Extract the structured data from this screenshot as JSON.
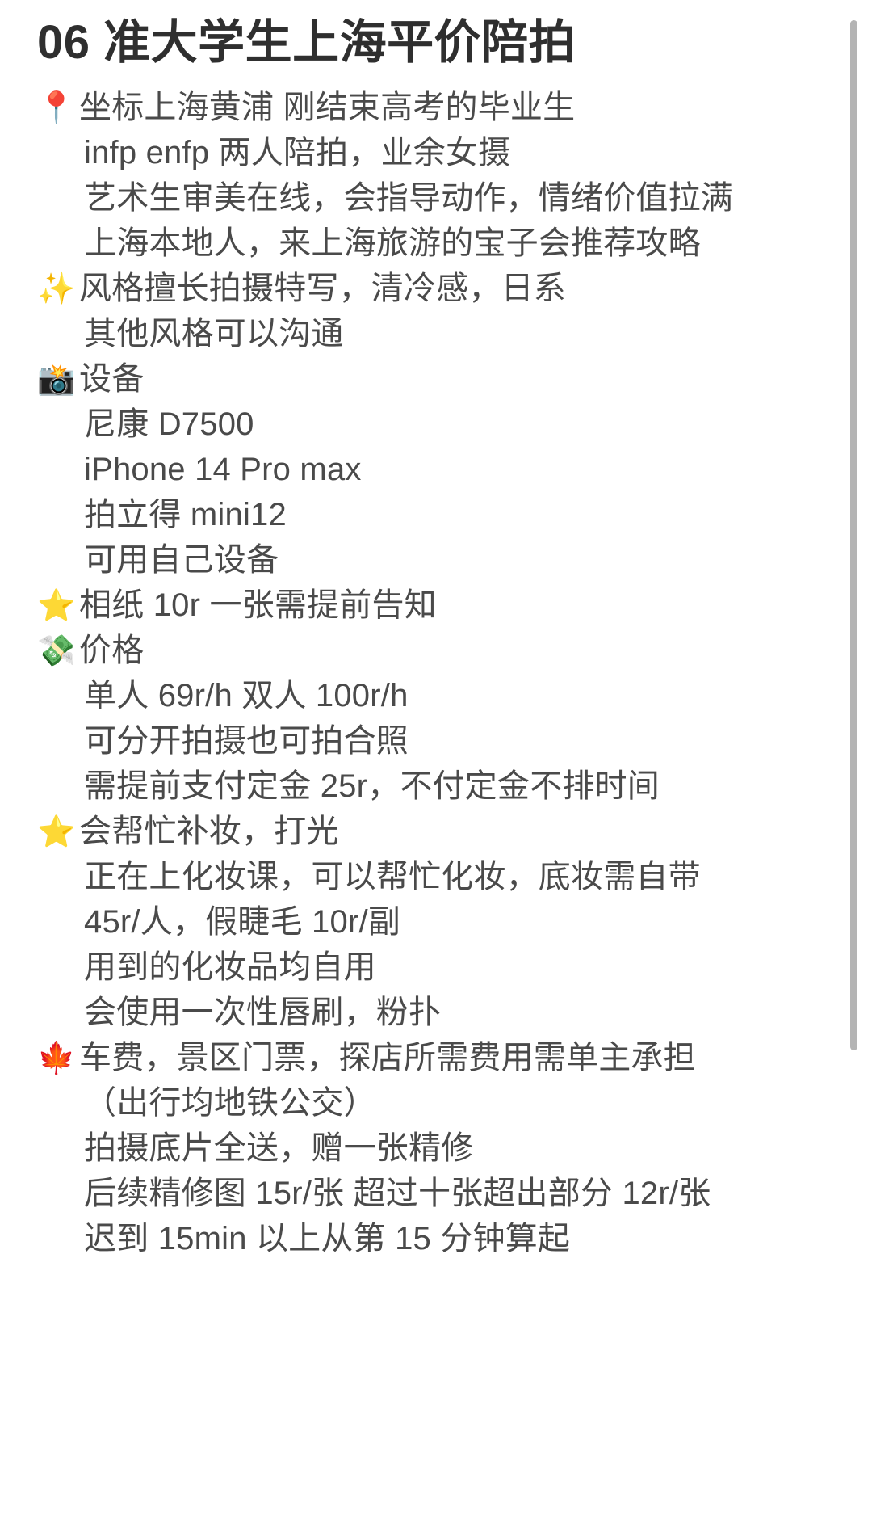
{
  "note": {
    "title": "06 准大学生上海平价陪拍",
    "lines": [
      {
        "emoji": "📍",
        "text": "坐标上海黄浦 刚结束高考的毕业生",
        "indent": false
      },
      {
        "emoji": "",
        "text": "infp enfp 两人陪拍，业余女摄",
        "indent": true
      },
      {
        "emoji": "",
        "text": "艺术生审美在线，会指导动作，情绪价值拉满",
        "indent": true
      },
      {
        "emoji": "",
        "text": "上海本地人，来上海旅游的宝子会推荐攻略",
        "indent": true
      },
      {
        "emoji": "✨",
        "text": "风格擅长拍摄特写，清冷感，日系",
        "indent": false
      },
      {
        "emoji": "",
        "text": "其他风格可以沟通",
        "indent": true
      },
      {
        "emoji": "📸",
        "text": "设备",
        "indent": false
      },
      {
        "emoji": "",
        "text": "尼康 D7500",
        "indent": true
      },
      {
        "emoji": "",
        "text": "iPhone 14 Pro max",
        "indent": true
      },
      {
        "emoji": "",
        "text": "拍立得 mini12",
        "indent": true
      },
      {
        "emoji": "",
        "text": "可用自己设备",
        "indent": true
      },
      {
        "emoji": "⭐",
        "text": "相纸 10r 一张需提前告知",
        "indent": false
      },
      {
        "emoji": "💸",
        "text": "价格",
        "indent": false
      },
      {
        "emoji": "",
        "text": "单人 69r/h 双人 100r/h",
        "indent": true
      },
      {
        "emoji": "",
        "text": "可分开拍摄也可拍合照",
        "indent": true
      },
      {
        "emoji": "",
        "text": "需提前支付定金 25r，不付定金不排时间",
        "indent": true
      },
      {
        "emoji": "⭐",
        "text": "会帮忙补妆，打光",
        "indent": false
      },
      {
        "emoji": "",
        "text": "正在上化妆课，可以帮忙化妆，底妆需自带",
        "indent": true
      },
      {
        "emoji": "",
        "text": "45r/人，假睫毛 10r/副",
        "indent": true
      },
      {
        "emoji": "",
        "text": "用到的化妆品均自用",
        "indent": true
      },
      {
        "emoji": "",
        "text": "会使用一次性唇刷，粉扑",
        "indent": true
      },
      {
        "emoji": "🍁",
        "text": "车费，景区门票，探店所需费用需单主承担",
        "indent": false
      },
      {
        "emoji": "",
        "text": "（出行均地铁公交）",
        "indent": true
      },
      {
        "emoji": "",
        "text": "拍摄底片全送，赠一张精修",
        "indent": true
      },
      {
        "emoji": "",
        "text": "后续精修图 15r/张 超过十张超出部分 12r/张",
        "indent": true
      },
      {
        "emoji": "",
        "text": "迟到 15min 以上从第 15 分钟算起",
        "indent": true
      }
    ]
  },
  "scrollbar": {
    "orientation": "vertical",
    "thumb_color": "#b4b4b4"
  },
  "colors": {
    "background": "#ffffff",
    "title_text": "#2f2f2f",
    "body_text": "#4a4a4a"
  }
}
